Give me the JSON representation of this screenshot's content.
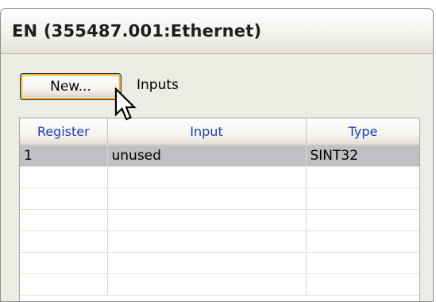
{
  "window": {
    "title": "EN (355487.001:Ethernet)"
  },
  "toolbar": {
    "new_button_label": "New...",
    "section_label": "Inputs"
  },
  "table": {
    "columns": [
      "Register",
      "Input",
      "Type"
    ],
    "rows": [
      {
        "register": "1",
        "input": "unused",
        "type": "SINT32",
        "selected": true
      },
      {
        "register": "",
        "input": "",
        "type": ""
      },
      {
        "register": "",
        "input": "",
        "type": ""
      },
      {
        "register": "",
        "input": "",
        "type": ""
      },
      {
        "register": "",
        "input": "",
        "type": ""
      },
      {
        "register": "",
        "input": "",
        "type": ""
      },
      {
        "register": "",
        "input": "",
        "type": ""
      }
    ]
  },
  "colors": {
    "header_text": "#1f3fb8",
    "selected_row": "#bfc0c4",
    "button_focus_border": "#f8b33b"
  },
  "icons": {
    "pointer": "arrow-cursor-icon"
  }
}
